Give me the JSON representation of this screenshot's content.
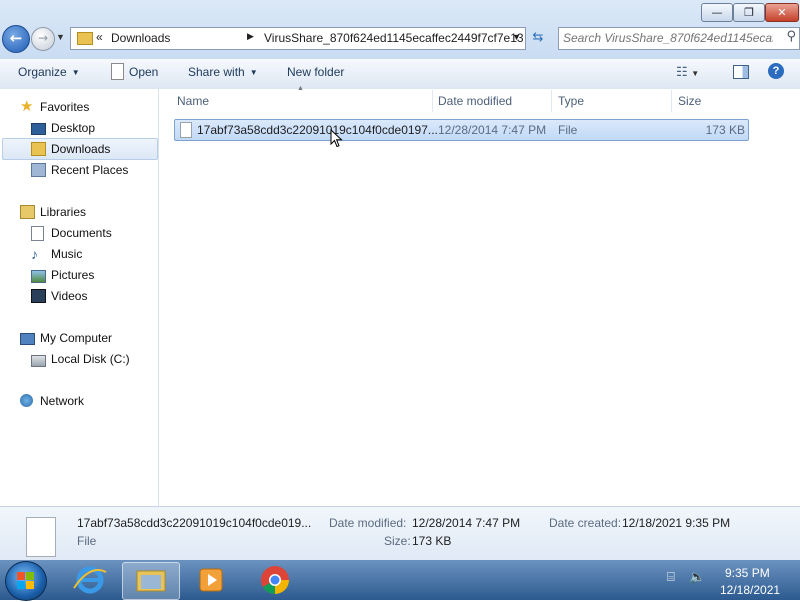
{
  "window": {
    "minimize_glyph": "—",
    "maximize_glyph": "❐",
    "close_glyph": "✕"
  },
  "address_bar": {
    "prefix": "«",
    "crumbs": [
      "Downloads",
      "VirusShare_870f624ed1145ecaffec2449f7cf7e13"
    ],
    "separator": "▶"
  },
  "search": {
    "placeholder": "Search VirusShare_870f624ed1145ecaf..."
  },
  "command_bar": {
    "organize": "Organize",
    "open": "Open",
    "share_with": "Share with",
    "new_folder": "New folder"
  },
  "nav": {
    "favorites": "Favorites",
    "desktop": "Desktop",
    "downloads": "Downloads",
    "recent_places": "Recent Places",
    "libraries": "Libraries",
    "documents": "Documents",
    "music": "Music",
    "pictures": "Pictures",
    "videos": "Videos",
    "my_computer": "My Computer",
    "local_disk": "Local Disk (C:)",
    "network": "Network"
  },
  "columns": {
    "name": "Name",
    "date_modified": "Date modified",
    "type": "Type",
    "size": "Size"
  },
  "files": [
    {
      "name": "17abf73a58cdd3c22091019c104f0cde0197...",
      "date_modified": "12/28/2014 7:47 PM",
      "type": "File",
      "size": "173 KB",
      "selected": true
    }
  ],
  "details": {
    "name": "17abf73a58cdd3c22091019c104f0cde019...",
    "type": "File",
    "date_modified_label": "Date modified:",
    "date_modified": "12/28/2014 7:47 PM",
    "date_created_label": "Date created:",
    "date_created": "12/18/2021 9:35 PM",
    "size_label": "Size:",
    "size": "173 KB"
  },
  "taskbar": {
    "apps": [
      "start-orb",
      "internet-explorer-icon",
      "windows-explorer-icon",
      "media-player-icon",
      "chrome-icon"
    ],
    "time": "9:35 PM",
    "date": "12/18/2021"
  },
  "colors": {
    "selection": "#cfe2fa",
    "accent": "#2b6cc0",
    "taskbar": "#2c5a8f"
  }
}
